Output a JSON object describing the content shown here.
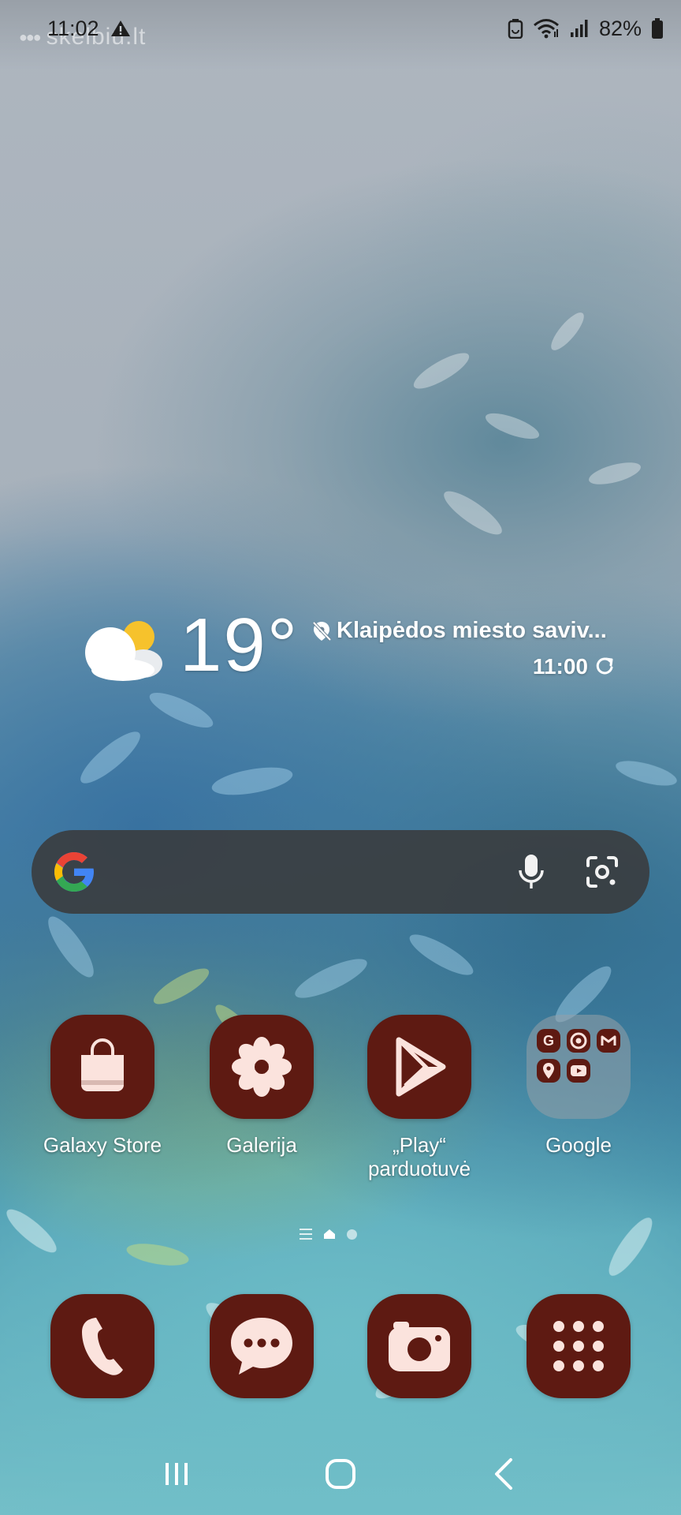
{
  "status_bar": {
    "time": "11:02",
    "battery_percent": "82%",
    "watermark": "skelbiu.lt"
  },
  "weather": {
    "temperature": "19°",
    "location": "Klaipėdos miesto saviv...",
    "updated_time": "11:00",
    "condition_icon": "partly-cloudy-icon"
  },
  "search": {
    "provider": "Google",
    "voice_icon": "mic-icon",
    "lens_icon": "lens-icon"
  },
  "apps": [
    {
      "label": "Galaxy Store",
      "icon": "shopping-bag-icon"
    },
    {
      "label": "Galerija",
      "icon": "flower-icon"
    },
    {
      "label": "„Play“ parduotuvė",
      "icon": "play-store-icon"
    },
    {
      "label": "Google",
      "icon": "folder-icon"
    }
  ],
  "google_folder_items": [
    "G",
    "Chrome",
    "Gmail",
    "Maps",
    "YouTube"
  ],
  "dock": [
    {
      "name": "Phone",
      "icon": "phone-icon"
    },
    {
      "name": "Messages",
      "icon": "messages-icon"
    },
    {
      "name": "Camera",
      "icon": "camera-icon"
    },
    {
      "name": "Apps",
      "icon": "app-drawer-icon"
    }
  ],
  "page_indicator": {
    "pages": 2,
    "current": 1
  },
  "colors": {
    "icon_bg": "#5e1a12",
    "icon_fg": "#fbe3dd",
    "search_bg": "#3a3c3e"
  }
}
